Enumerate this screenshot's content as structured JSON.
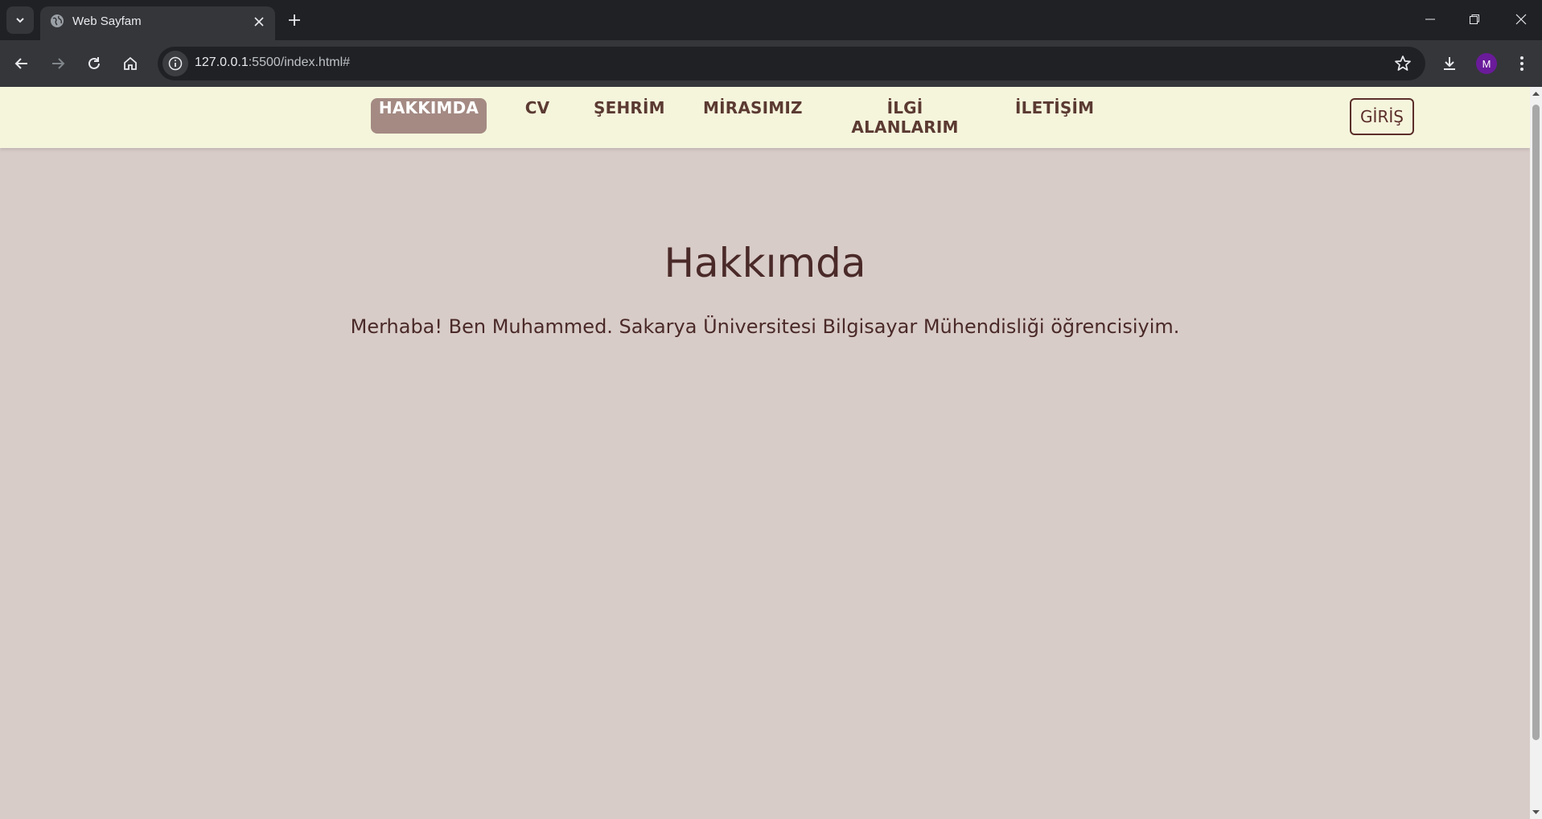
{
  "browser": {
    "tab": {
      "title": "Web Sayfam"
    },
    "address_bar": {
      "host": "127.0.0.1",
      "path": ":5500/index.html#"
    },
    "profile_initial": "M",
    "colors": {
      "avatar": "#6a1b9a",
      "chrome_dark": "#202124",
      "chrome_toolbar": "#35363a"
    }
  },
  "site": {
    "nav": {
      "items": [
        {
          "label": "HAKKIMDA",
          "active": true
        },
        {
          "label": "CV",
          "active": false
        },
        {
          "label": "ŞEHRİM",
          "active": false
        },
        {
          "label": "MİRASIMIZ",
          "active": false
        },
        {
          "label": "İLGİ ALANLARIM",
          "active": false
        },
        {
          "label": "İLETİŞİM",
          "active": false
        }
      ],
      "login_label": "GİRİŞ"
    },
    "main": {
      "title": "Hakkımda",
      "text": "Merhaba! Ben Muhammed. Sakarya Üniversitesi Bilgisayar Mühendisliği öğrencisiyim."
    },
    "colors": {
      "nav_background": "#f5f5dc",
      "page_background": "#d8ccc8",
      "active_nav": "#a48a83",
      "text": "#4a2a29"
    }
  }
}
